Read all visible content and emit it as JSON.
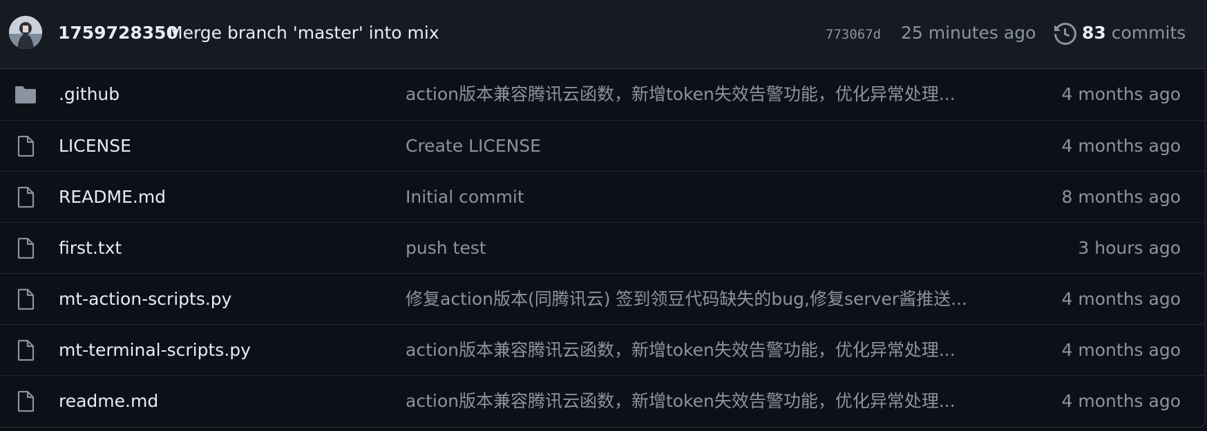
{
  "latest_commit": {
    "author": "1759728350",
    "message": "Merge branch 'master' into mix",
    "sha": "773067d",
    "time": "25 minutes ago",
    "commits_count": "83",
    "commits_label": "commits"
  },
  "files": [
    {
      "type": "folder",
      "icon": "folder-icon",
      "name": ".github",
      "message": "action版本兼容腾讯云函数，新增token失效告警功能，优化异常处理...",
      "age": "4 months ago"
    },
    {
      "type": "file",
      "icon": "file-icon",
      "name": "LICENSE",
      "message": "Create LICENSE",
      "age": "4 months ago"
    },
    {
      "type": "file",
      "icon": "file-icon",
      "name": "README.md",
      "message": "Initial commit",
      "age": "8 months ago"
    },
    {
      "type": "file",
      "icon": "file-icon",
      "name": "first.txt",
      "message": "push test",
      "age": "3 hours ago"
    },
    {
      "type": "file",
      "icon": "file-icon",
      "name": "mt-action-scripts.py",
      "message": "修复action版本(同腾讯云) 签到领豆代码缺失的bug,修复server酱推送...",
      "age": "4 months ago"
    },
    {
      "type": "file",
      "icon": "file-icon",
      "name": "mt-terminal-scripts.py",
      "message": "action版本兼容腾讯云函数，新增token失效告警功能，优化异常处理...",
      "age": "4 months ago"
    },
    {
      "type": "file",
      "icon": "file-icon",
      "name": "readme.md",
      "message": "action版本兼容腾讯云函数，新增token失效告警功能，优化异常处理...",
      "age": "4 months ago"
    }
  ],
  "colors": {
    "background": "#0d1117",
    "header_background": "#161b22",
    "border": "#30363d",
    "text_primary": "#e6edf3",
    "text_muted": "#8b949e",
    "icon": "#8b949e"
  }
}
